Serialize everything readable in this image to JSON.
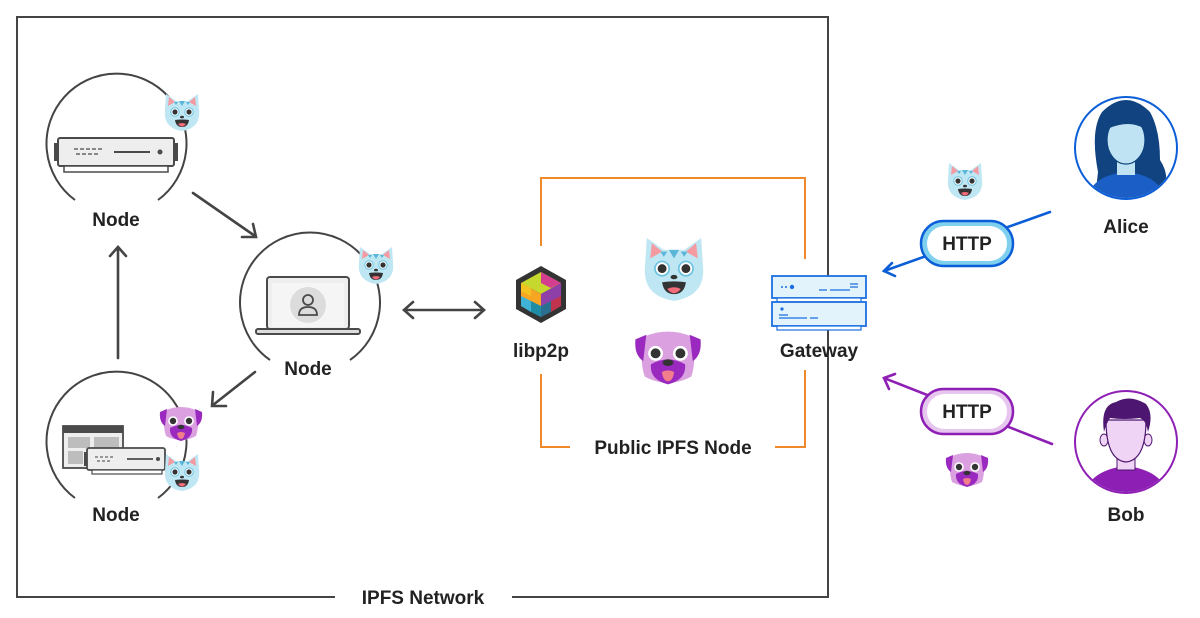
{
  "network": {
    "label": "IPFS Network"
  },
  "nodes": [
    {
      "id": "node-top-left",
      "label": "Node",
      "device": "server",
      "content": [
        "cat"
      ]
    },
    {
      "id": "node-center",
      "label": "Node",
      "device": "laptop",
      "content": [
        "cat"
      ]
    },
    {
      "id": "node-bottom-left",
      "label": "Node",
      "device": "browser-and-server",
      "content": [
        "pug",
        "cat"
      ]
    }
  ],
  "public_node": {
    "label": "Public IPFS Node",
    "libp2p_label": "libp2p",
    "gateway_label": "Gateway",
    "content": [
      "cat",
      "pug"
    ]
  },
  "users": [
    {
      "name": "Alice",
      "protocol": "HTTP",
      "content": "cat",
      "color": "#0b5ed7"
    },
    {
      "name": "Bob",
      "protocol": "HTTP",
      "content": "pug",
      "color": "#8e1fb5"
    }
  ],
  "colors": {
    "frame": "#444444",
    "public_node_frame": "#f0892b",
    "alice": "#0b5ed7",
    "bob": "#8e1fb5"
  }
}
